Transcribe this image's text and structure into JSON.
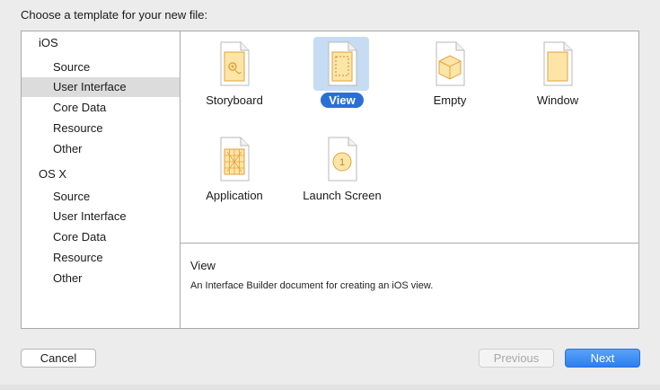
{
  "dialog": {
    "title": "Choose a template for your new file:"
  },
  "sidebar": {
    "groups": [
      {
        "label": "iOS",
        "items": [
          "Source",
          "User Interface",
          "Core Data",
          "Resource",
          "Other"
        ]
      },
      {
        "label": "OS X",
        "items": [
          "Source",
          "User Interface",
          "Core Data",
          "Resource",
          "Other"
        ]
      }
    ],
    "selected": "iOS / User Interface"
  },
  "templates": [
    {
      "label": "Storyboard",
      "icon": "storyboard-icon"
    },
    {
      "label": "View",
      "icon": "view-icon",
      "selected": true
    },
    {
      "label": "Empty",
      "icon": "empty-icon"
    },
    {
      "label": "Window",
      "icon": "window-icon"
    },
    {
      "label": "Application",
      "icon": "application-icon"
    },
    {
      "label": "Launch Screen",
      "icon": "launch-screen-icon",
      "badge": "1"
    }
  ],
  "description": {
    "title": "View",
    "text": "An Interface Builder document for creating an iOS view."
  },
  "buttons": {
    "cancel": "Cancel",
    "previous": "Previous",
    "next": "Next"
  },
  "colors": {
    "accent": "#2a6fd6",
    "selection": "#c6dcf3",
    "icon_fill": "#fde5a8",
    "icon_stroke": "#e1a23c"
  }
}
